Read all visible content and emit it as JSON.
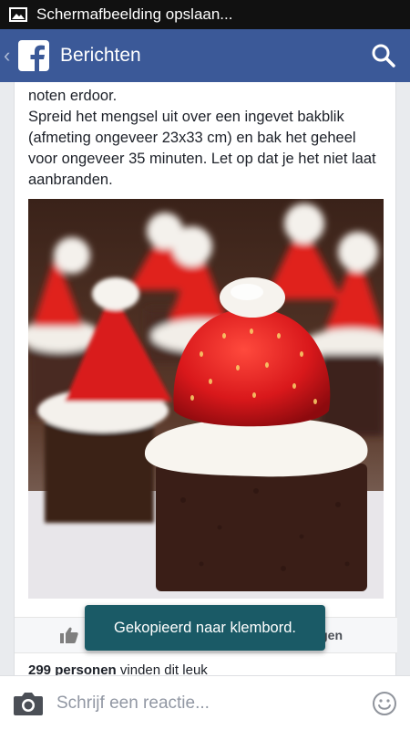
{
  "statusbar": {
    "notification": "Schermafbeelding opslaan..."
  },
  "appbar": {
    "title": "Berichten"
  },
  "post": {
    "lines": [
      "noten erdoor.",
      "Spreid het mengsel uit over een ingevet bakblik (afmeting ongeveer 23x33 cm) en bak het geheel voor ongeveer 35 minuten. Let op dat je het niet laat aanbranden."
    ]
  },
  "actions": {
    "like_label": "Vi",
    "share_label": "gen"
  },
  "likes": {
    "count": "299 personen",
    "suffix": "vinden dit leuk"
  },
  "toast": {
    "text": "Gekopieerd naar klembord."
  },
  "composer": {
    "placeholder": "Schrijf een reactie..."
  },
  "colors": {
    "brand": "#3b5998",
    "toast": "#1a5a66",
    "statusbar": "#111111"
  }
}
